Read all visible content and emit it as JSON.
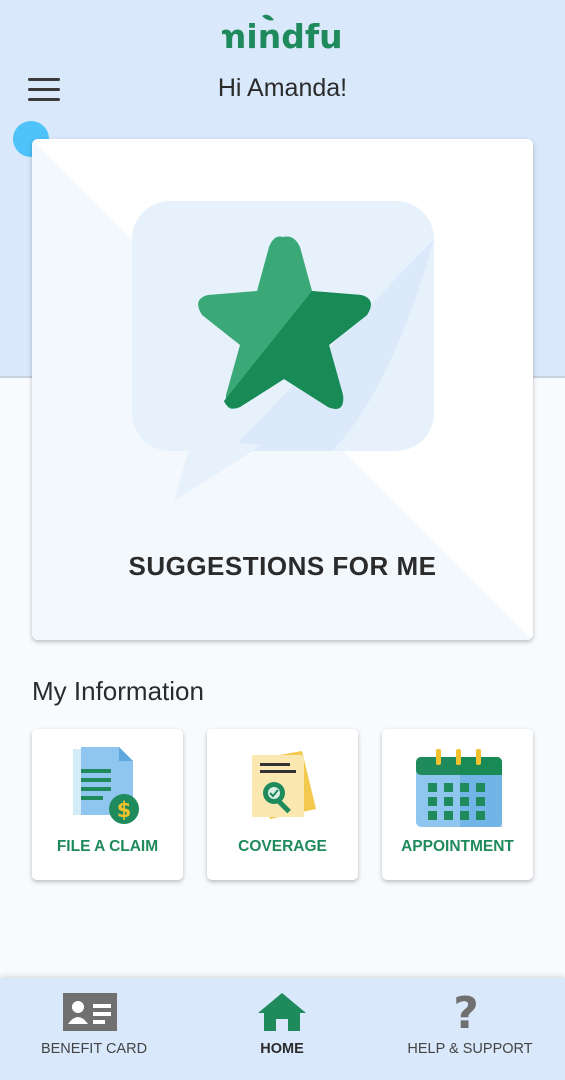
{
  "header": {
    "brand": "mindful",
    "greeting": "Hi Amanda!",
    "menu_icon": "hamburger-menu-icon"
  },
  "hero": {
    "title": "SUGGESTIONS FOR ME",
    "icon": "star-speech-bubble-icon"
  },
  "info": {
    "section_title": "My Information",
    "tiles": [
      {
        "label": "FILE A CLAIM",
        "icon": "claim-document-dollar-icon"
      },
      {
        "label": "COVERAGE",
        "icon": "coverage-magnifier-icon"
      },
      {
        "label": "APPOINTMENT",
        "icon": "calendar-icon"
      }
    ]
  },
  "nav": {
    "items": [
      {
        "label": "BENEFIT CARD",
        "icon": "id-card-icon"
      },
      {
        "label": "HOME",
        "icon": "home-icon",
        "active": true
      },
      {
        "label": "HELP & SUPPORT",
        "icon": "question-mark-icon"
      }
    ]
  },
  "colors": {
    "brand_green": "#1f8a5b",
    "light_blue": "#d9e8fb",
    "indicator_blue": "#4dc3fa"
  }
}
